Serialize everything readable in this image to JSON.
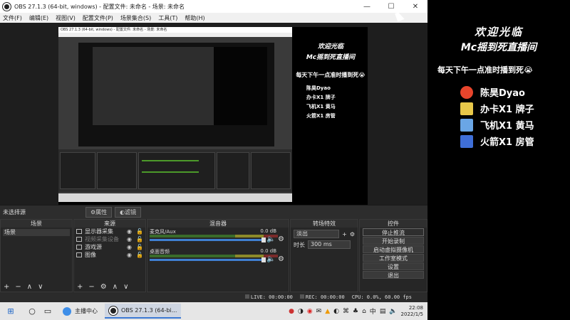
{
  "window": {
    "title": "OBS 27.1.3 (64-bit, windows) - 配置文件: 未命名 - 场景: 未命名",
    "controls": [
      "—",
      "☐",
      "✕"
    ]
  },
  "menu": [
    "文件(F)",
    "编辑(E)",
    "视图(V)",
    "配置文件(P)",
    "场景集合(S)",
    "工具(T)",
    "帮助(H)"
  ],
  "canvas_overlay": {
    "welcome": "欢迎光临",
    "subtitle": "Mc摇到死直播间",
    "notice": "每天下午一点准时播到死😭",
    "rows": [
      "陈昊Dyao",
      "办卡X1 牌子",
      "飞机X1 黄马",
      "火箭X1 房管"
    ]
  },
  "nested_title": "OBS 27.1.3 (64-bit, windows) - 配置文件: 未命名 - 场景: 未命名",
  "context_bar": {
    "no_selection": "未选择源",
    "properties": "⚙属性",
    "filters": "◐滤镜"
  },
  "scenes": {
    "header": "场景",
    "items": [
      "场景"
    ]
  },
  "sources": {
    "header": "来源",
    "items": [
      {
        "label": "显示器采集",
        "dim": false
      },
      {
        "label": "视频采集设备",
        "dim": true
      },
      {
        "label": "游戏源",
        "dim": false
      },
      {
        "label": "图像",
        "dim": false
      }
    ]
  },
  "mixer": {
    "header": "混音器",
    "channels": [
      {
        "name": "麦克风/Aux",
        "value": "0.0 dB"
      },
      {
        "name": "桌面音频",
        "value": "0.0 dB"
      }
    ]
  },
  "transitions": {
    "header": "转场特效",
    "selected": "淡出",
    "duration_label": "时长",
    "duration_value": "300 ms"
  },
  "controls": {
    "header": "控件",
    "buttons": [
      "停止推流",
      "开始录制",
      "启动虚拟摄像机",
      "工作室模式",
      "设置",
      "退出"
    ]
  },
  "status": {
    "live": "LIVE: 00:00:00",
    "rec": "REC: 00:00:00",
    "cpu": "CPU: 0.0%, 60.00 fps"
  },
  "taskbar": {
    "apps": [
      "主播中心",
      "OBS 27.1.3 (64-bi..."
    ],
    "time": "22:08",
    "date": "2022/1/5"
  },
  "side_overlay": {
    "welcome": "欢迎光临",
    "subtitle": "Mc摇到死直播间",
    "notice": "每天下午一点准时播到死😭",
    "rows": [
      {
        "text": "陈昊Dyao",
        "color": "#e8452c"
      },
      {
        "text": "办卡X1 牌子",
        "color": "#e8c84a"
      },
      {
        "text": "飞机X1 黄马",
        "color": "#6aa6e6"
      },
      {
        "text": "火箭X1 房管",
        "color": "#3f6fd8"
      }
    ]
  }
}
